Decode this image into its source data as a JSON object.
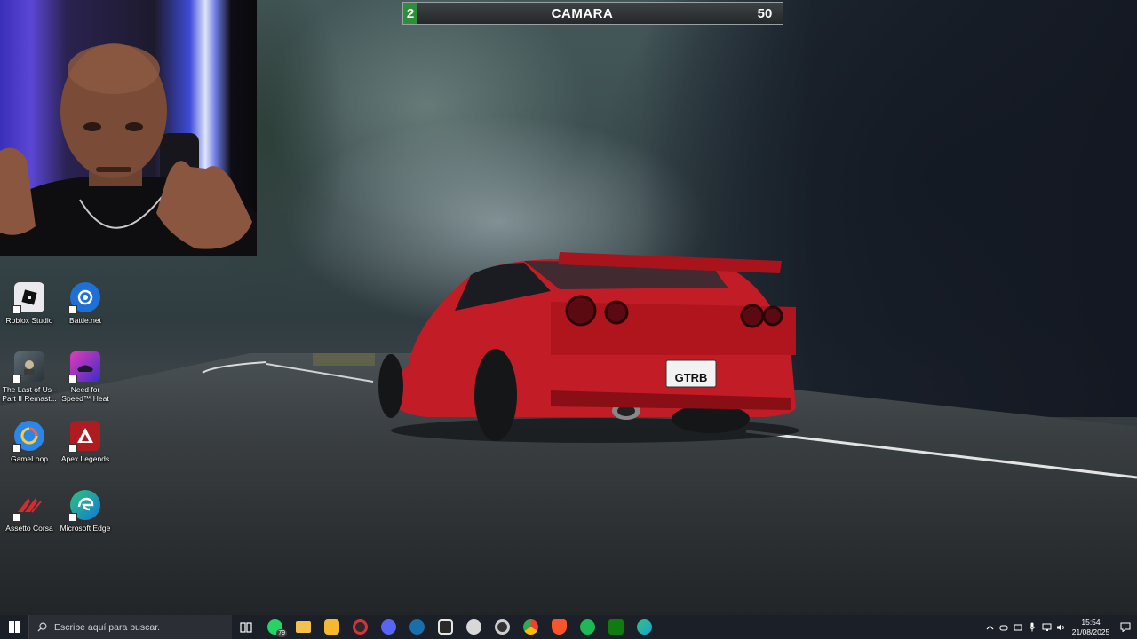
{
  "scoreboard": {
    "left_score": "2",
    "title": "CAMARA",
    "right_score": "50"
  },
  "license_plate": "GTRB",
  "desktop_icons": [
    {
      "label": "Roblox Studio",
      "icon": "roblox-studio-icon"
    },
    {
      "label": "Battle.net",
      "icon": "battlenet-icon"
    },
    {
      "label": "The Last of Us - Part II Remast...",
      "icon": "the-last-of-us-icon"
    },
    {
      "label": "Need for Speed™ Heat",
      "icon": "need-for-speed-heat-icon"
    },
    {
      "label": "GameLoop",
      "icon": "gameloop-icon"
    },
    {
      "label": "Apex Legends",
      "icon": "apex-legends-icon"
    },
    {
      "label": "Assetto Corsa",
      "icon": "assetto-corsa-icon"
    },
    {
      "label": "Microsoft Edge",
      "icon": "microsoft-edge-icon"
    }
  ],
  "taskbar": {
    "search_placeholder": "Escribe aquí para buscar.",
    "apps": [
      {
        "icon": "whatsapp-icon",
        "badge": "79",
        "color": "#25d366"
      },
      {
        "icon": "file-explorer-icon",
        "color": "#f2c14e"
      },
      {
        "icon": "microsoft-store-icon",
        "color": "#f5b82e"
      },
      {
        "icon": "recorder-icon",
        "color": "#d6323a"
      },
      {
        "icon": "discord-icon",
        "color": "#5865f2"
      },
      {
        "icon": "steam-icon",
        "color": "#1b6fa8"
      },
      {
        "icon": "epic-games-icon",
        "color": "#e6e6e6"
      },
      {
        "icon": "davinci-resolve-icon",
        "color": "#d8d8d8"
      },
      {
        "icon": "obs-icon",
        "color": "#cfcfcf"
      },
      {
        "icon": "chrome-icon",
        "color": "#4285f4"
      },
      {
        "icon": "brave-icon",
        "color": "#fb542b"
      },
      {
        "icon": "spotify-icon",
        "color": "#1db954"
      },
      {
        "icon": "xbox-icon",
        "color": "#107c10"
      },
      {
        "icon": "edge-icon",
        "color": "#1f9fd8"
      }
    ],
    "tray": [
      "chevron-up-icon",
      "gamepad-icon",
      "meet-now-icon",
      "microphone-icon",
      "network-icon",
      "volume-icon"
    ],
    "time": "15:54",
    "date": "21/08/2025"
  }
}
